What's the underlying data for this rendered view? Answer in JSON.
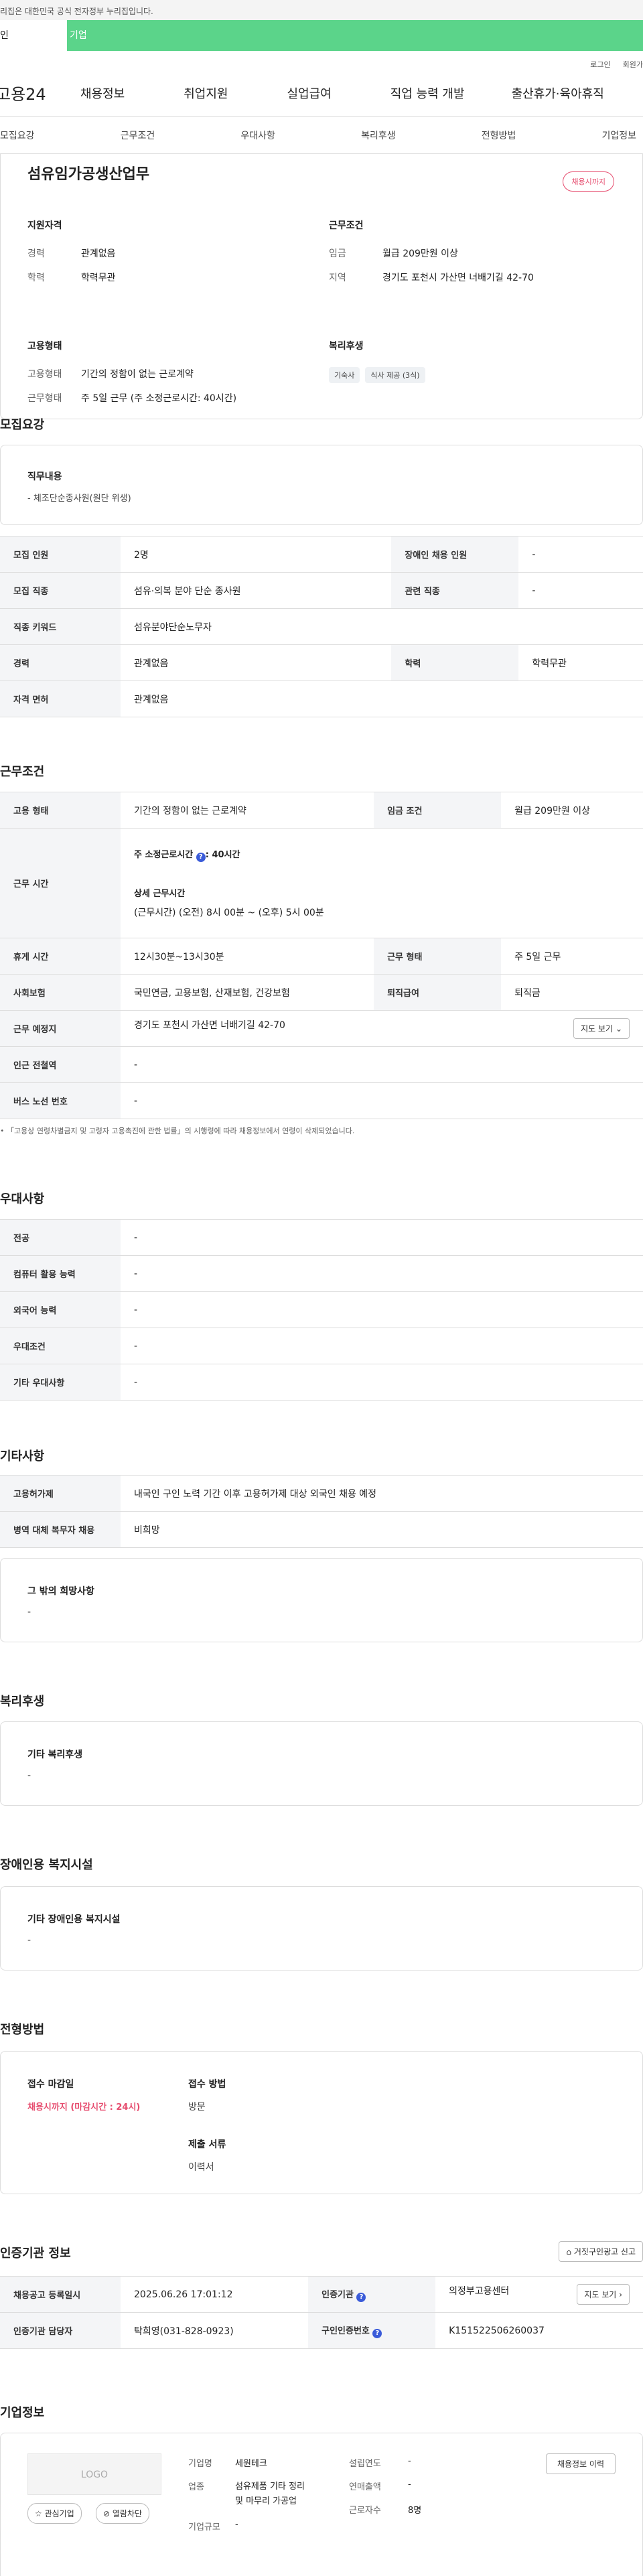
{
  "gov_banner": "리집은 대한민국 공식 전자정부 누리집입니다.",
  "user_tabs": {
    "person": "인",
    "company": "기업"
  },
  "top_links": {
    "login": "로그인",
    "signup": "회원가"
  },
  "gnb": {
    "logo": "고용24",
    "items": [
      "채용정보",
      "취업지원",
      "실업급여",
      "직업 능력 개발",
      "출산휴가·육아휴직"
    ]
  },
  "subnav": [
    "모집요강",
    "근무조건",
    "우대사항",
    "복리후생",
    "전형방법",
    "기업정보"
  ],
  "summary": {
    "title": "섬유임가공생산업무",
    "status": "채용시까지",
    "qual_title": "지원자격",
    "qual": [
      {
        "k": "경력",
        "v": "관계없음"
      },
      {
        "k": "학력",
        "v": "학력무관"
      }
    ],
    "emp_title": "고용형태",
    "emp": [
      {
        "k": "고용형태",
        "v": "기간의 정함이 없는 근로계약"
      },
      {
        "k": "근무형태",
        "v": "주 5일 근무 (주 소정근로시간: 40시간)"
      }
    ],
    "cond_title": "근무조건",
    "cond": [
      {
        "k": "임금",
        "v": "월급 209만원 이상"
      },
      {
        "k": "지역",
        "v": "경기도 포천시 가산면 너배기길 42-70"
      }
    ],
    "welfare_title": "복리후생",
    "welfare_chips": [
      "기숙사",
      "식사 제공 (3식)"
    ]
  },
  "recruit": {
    "title": "모집요강",
    "duty_title": "직무내용",
    "duty_value": "- 체조단순종사원(원단 위생)",
    "rows": [
      {
        "h1": "모집 인원",
        "v1": "2명",
        "h2": "장애인 채용 인원",
        "v2": "-"
      },
      {
        "h1": "모집 직종",
        "v1": "섬유·의복 분야 단순 종사원",
        "h2": "관련 직종",
        "v2": "-"
      },
      {
        "h1": "직종 키워드",
        "v1": "섬유분야단순노무자"
      },
      {
        "h1": "경력",
        "v1": "관계없음",
        "h2": "학력",
        "v2": "학력무관"
      },
      {
        "h1": "자격 면허",
        "v1": "관계없음"
      }
    ]
  },
  "work": {
    "title": "근무조건",
    "emp_type_h": "고용 형태",
    "emp_type_v": "기간의 정함이 없는 근로계약",
    "wage_h": "임금 조건",
    "wage_v": "월급 209만원 이상",
    "hours_h": "근무 시간",
    "hours_weekly": "주 소정근로시간 : 40시간",
    "hours_detail_t": "상세 근무시간",
    "hours_detail_v": "(근무시간) (오전) 8시 00분 ~ (오후) 5시 00분",
    "break_h": "휴게 시간",
    "break_v": "12시30분~13시30분",
    "form_h": "근무 형태",
    "form_v": "주 5일 근무",
    "ins_h": "사회보험",
    "ins_v": "국민연금, 고용보험, 산재보험, 건강보험",
    "sev_h": "퇴직급여",
    "sev_v": "퇴직금",
    "place_h": "근무 예정지",
    "place_v": "경기도 포천시 가산면 너배기길 42-70",
    "map_btn": "지도 보기",
    "subway_h": "인근 전철역",
    "subway_v": "-",
    "bus_h": "버스 노선 번호",
    "bus_v": "-",
    "note": "「고용상 연령차별금지 및 고령자 고용촉진에 관한 법률」의 시행령에 따라 채용정보에서 연령이 삭제되었습니다."
  },
  "pref": {
    "title": "우대사항",
    "rows": [
      {
        "h": "전공",
        "v": "-"
      },
      {
        "h": "컴퓨터 활용 능력",
        "v": "-"
      },
      {
        "h": "외국어 능력",
        "v": "-"
      },
      {
        "h": "우대조건",
        "v": "-"
      },
      {
        "h": "기타 우대사항",
        "v": "-"
      }
    ]
  },
  "etc": {
    "title": "기타사항",
    "rows": [
      {
        "h": "고용허가제",
        "v": "내국인 구인 노력 기간 이후 고용허가제 대상 외국인 채용 예정"
      },
      {
        "h": "병역 대체 복무자 채용",
        "v": "비희망"
      }
    ],
    "other_title": "그 밖의 희망사항",
    "other_value": "-"
  },
  "welfare": {
    "title": "복리후생",
    "box_title": "기타 복리후생",
    "box_value": "-"
  },
  "disabled": {
    "title": "장애인용 복지시설",
    "box_title": "기타 장애인용 복지시설",
    "box_value": "-"
  },
  "selection": {
    "title": "전형방법",
    "deadline_t": "접수 마감일",
    "deadline_v": "채용시까지 (마감시간 : 24시)",
    "method_t": "접수 방법",
    "method_v": "방문",
    "docs_t": "제출 서류",
    "docs_v": "이력서"
  },
  "auth": {
    "title": "인증기관 정보",
    "report_btn": "거짓구인광고 신고",
    "reg_h": "채용공고 등록일시",
    "reg_v": "2025.06.26 17:01:12",
    "org_h": "인증기관",
    "org_v": "의정부고용센터",
    "map_btn": "지도 보기",
    "mgr_h": "인증기관 담당자",
    "mgr_v": "탁희영(031-828-0923)",
    "no_h": "구인인증번호",
    "no_v": "K151522506260037"
  },
  "company": {
    "title": "기업정보",
    "logo": "LOGO",
    "fav_btn": "관심기업",
    "block_btn": "열람차단",
    "name_k": "기업명",
    "name_v": "세원테크",
    "ind_k": "업종",
    "ind_v": "섬유제품 기타 정리 및 마무리 가공업",
    "size_k": "기업규모",
    "size_v": "-",
    "est_k": "설립연도",
    "est_v": "-",
    "sales_k": "연매출액",
    "sales_v": "-",
    "emp_k": "근로자수",
    "emp_v": "8명",
    "history_btn": "채용정보 이력"
  },
  "colors": {
    "accent_green": "#5bd48a",
    "accent_red": "#e64c6e",
    "info_blue": "#3a5bd9"
  }
}
